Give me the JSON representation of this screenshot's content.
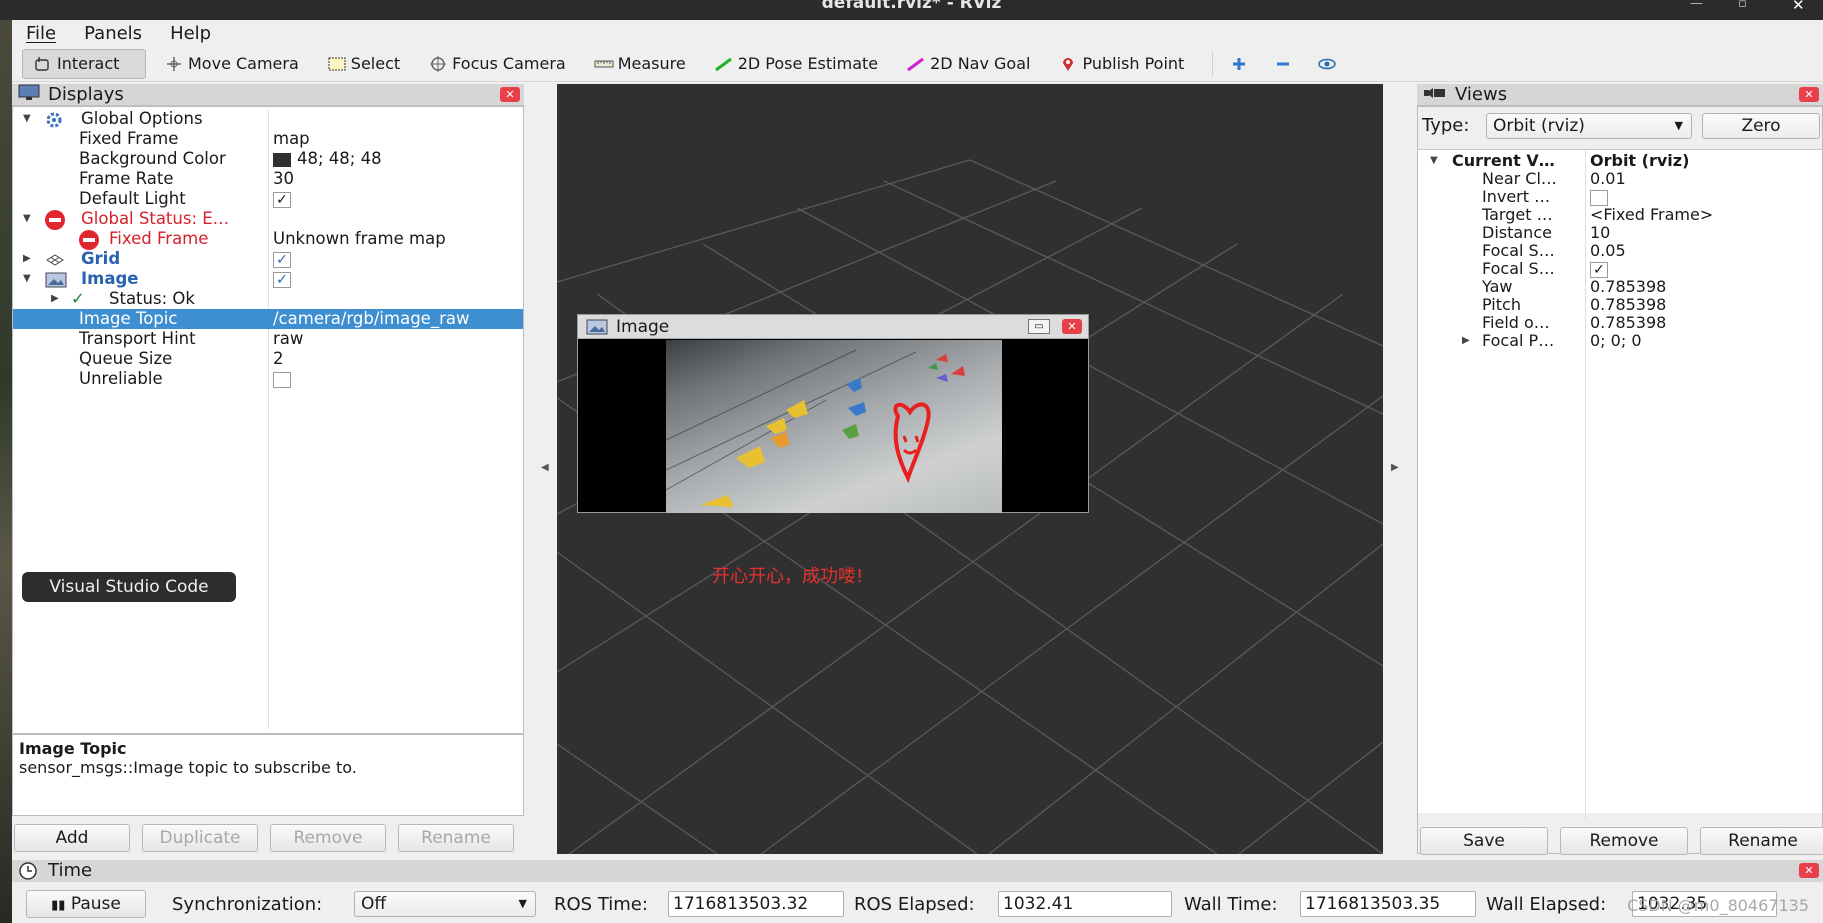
{
  "window": {
    "title": "default.rviz* - RViz"
  },
  "menu": [
    "File",
    "Panels",
    "Help"
  ],
  "toolbar": {
    "tools": [
      "Interact",
      "Move Camera",
      "Select",
      "Focus Camera",
      "Measure",
      "2D Pose Estimate",
      "2D Nav Goal",
      "Publish Point"
    ],
    "colors": {
      "pose": "#20b020",
      "nav": "#d020d0",
      "publish": "#d03030",
      "plus": "#2a7ad0"
    }
  },
  "displays": {
    "title": "Displays",
    "rows": {
      "global_options": "Global Options",
      "fixed_frame_k": "Fixed Frame",
      "fixed_frame_v": "map",
      "bg_color_k": "Background Color",
      "bg_color_v": "48; 48; 48",
      "frame_rate_k": "Frame Rate",
      "frame_rate_v": "30",
      "default_light_k": "Default Light",
      "global_status": "Global Status: E…",
      "fixed_frame_err_k": "Fixed Frame",
      "fixed_frame_err_v": "Unknown frame map",
      "grid": "Grid",
      "image": "Image",
      "status_ok": "Status: Ok",
      "image_topic_k": "Image Topic",
      "image_topic_v": "/camera/rgb/image_raw",
      "transport_k": "Transport Hint",
      "transport_v": "raw",
      "queue_k": "Queue Size",
      "queue_v": "2",
      "unreliable_k": "Unreliable"
    },
    "desc_title": "Image Topic",
    "desc_body": "sensor_msgs::Image topic to subscribe to.",
    "buttons": {
      "add": "Add",
      "duplicate": "Duplicate",
      "remove": "Remove",
      "rename": "Rename"
    }
  },
  "tooltip": "Visual Studio Code",
  "image_window": {
    "title": "Image"
  },
  "overlay_text": "开心开心，成功喽!",
  "views": {
    "title": "Views",
    "type_label": "Type:",
    "type_value": "Orbit (rviz)",
    "zero": "Zero",
    "current_k": "Current V…",
    "current_v": "Orbit (rviz)",
    "rows": [
      {
        "k": "Near Cl…",
        "v": "0.01"
      },
      {
        "k": "Invert …",
        "v": ""
      },
      {
        "k": "Target …",
        "v": "<Fixed Frame>"
      },
      {
        "k": "Distance",
        "v": "10"
      },
      {
        "k": "Focal S…",
        "v": "0.05"
      },
      {
        "k": "Focal S…",
        "v": ""
      },
      {
        "k": "Yaw",
        "v": "0.785398"
      },
      {
        "k": "Pitch",
        "v": "0.785398"
      },
      {
        "k": "Field o…",
        "v": "0.785398"
      },
      {
        "k": "Focal P…",
        "v": "0; 0; 0"
      }
    ],
    "buttons": {
      "save": "Save",
      "remove": "Remove",
      "rename": "Rename"
    }
  },
  "time": {
    "title": "Time",
    "pause": "Pause",
    "sync_label": "Synchronization:",
    "sync_value": "Off",
    "ros_time_label": "ROS Time:",
    "ros_time": "1716813503.32",
    "ros_elapsed_label": "ROS Elapsed:",
    "ros_elapsed": "1032.41",
    "wall_time_label": "Wall Time:",
    "wall_time": "1716813503.35",
    "wall_elapsed_label": "Wall Elapsed:",
    "wall_elapsed": "1032.35",
    "watermark": "CSDN @m0_80467135"
  }
}
